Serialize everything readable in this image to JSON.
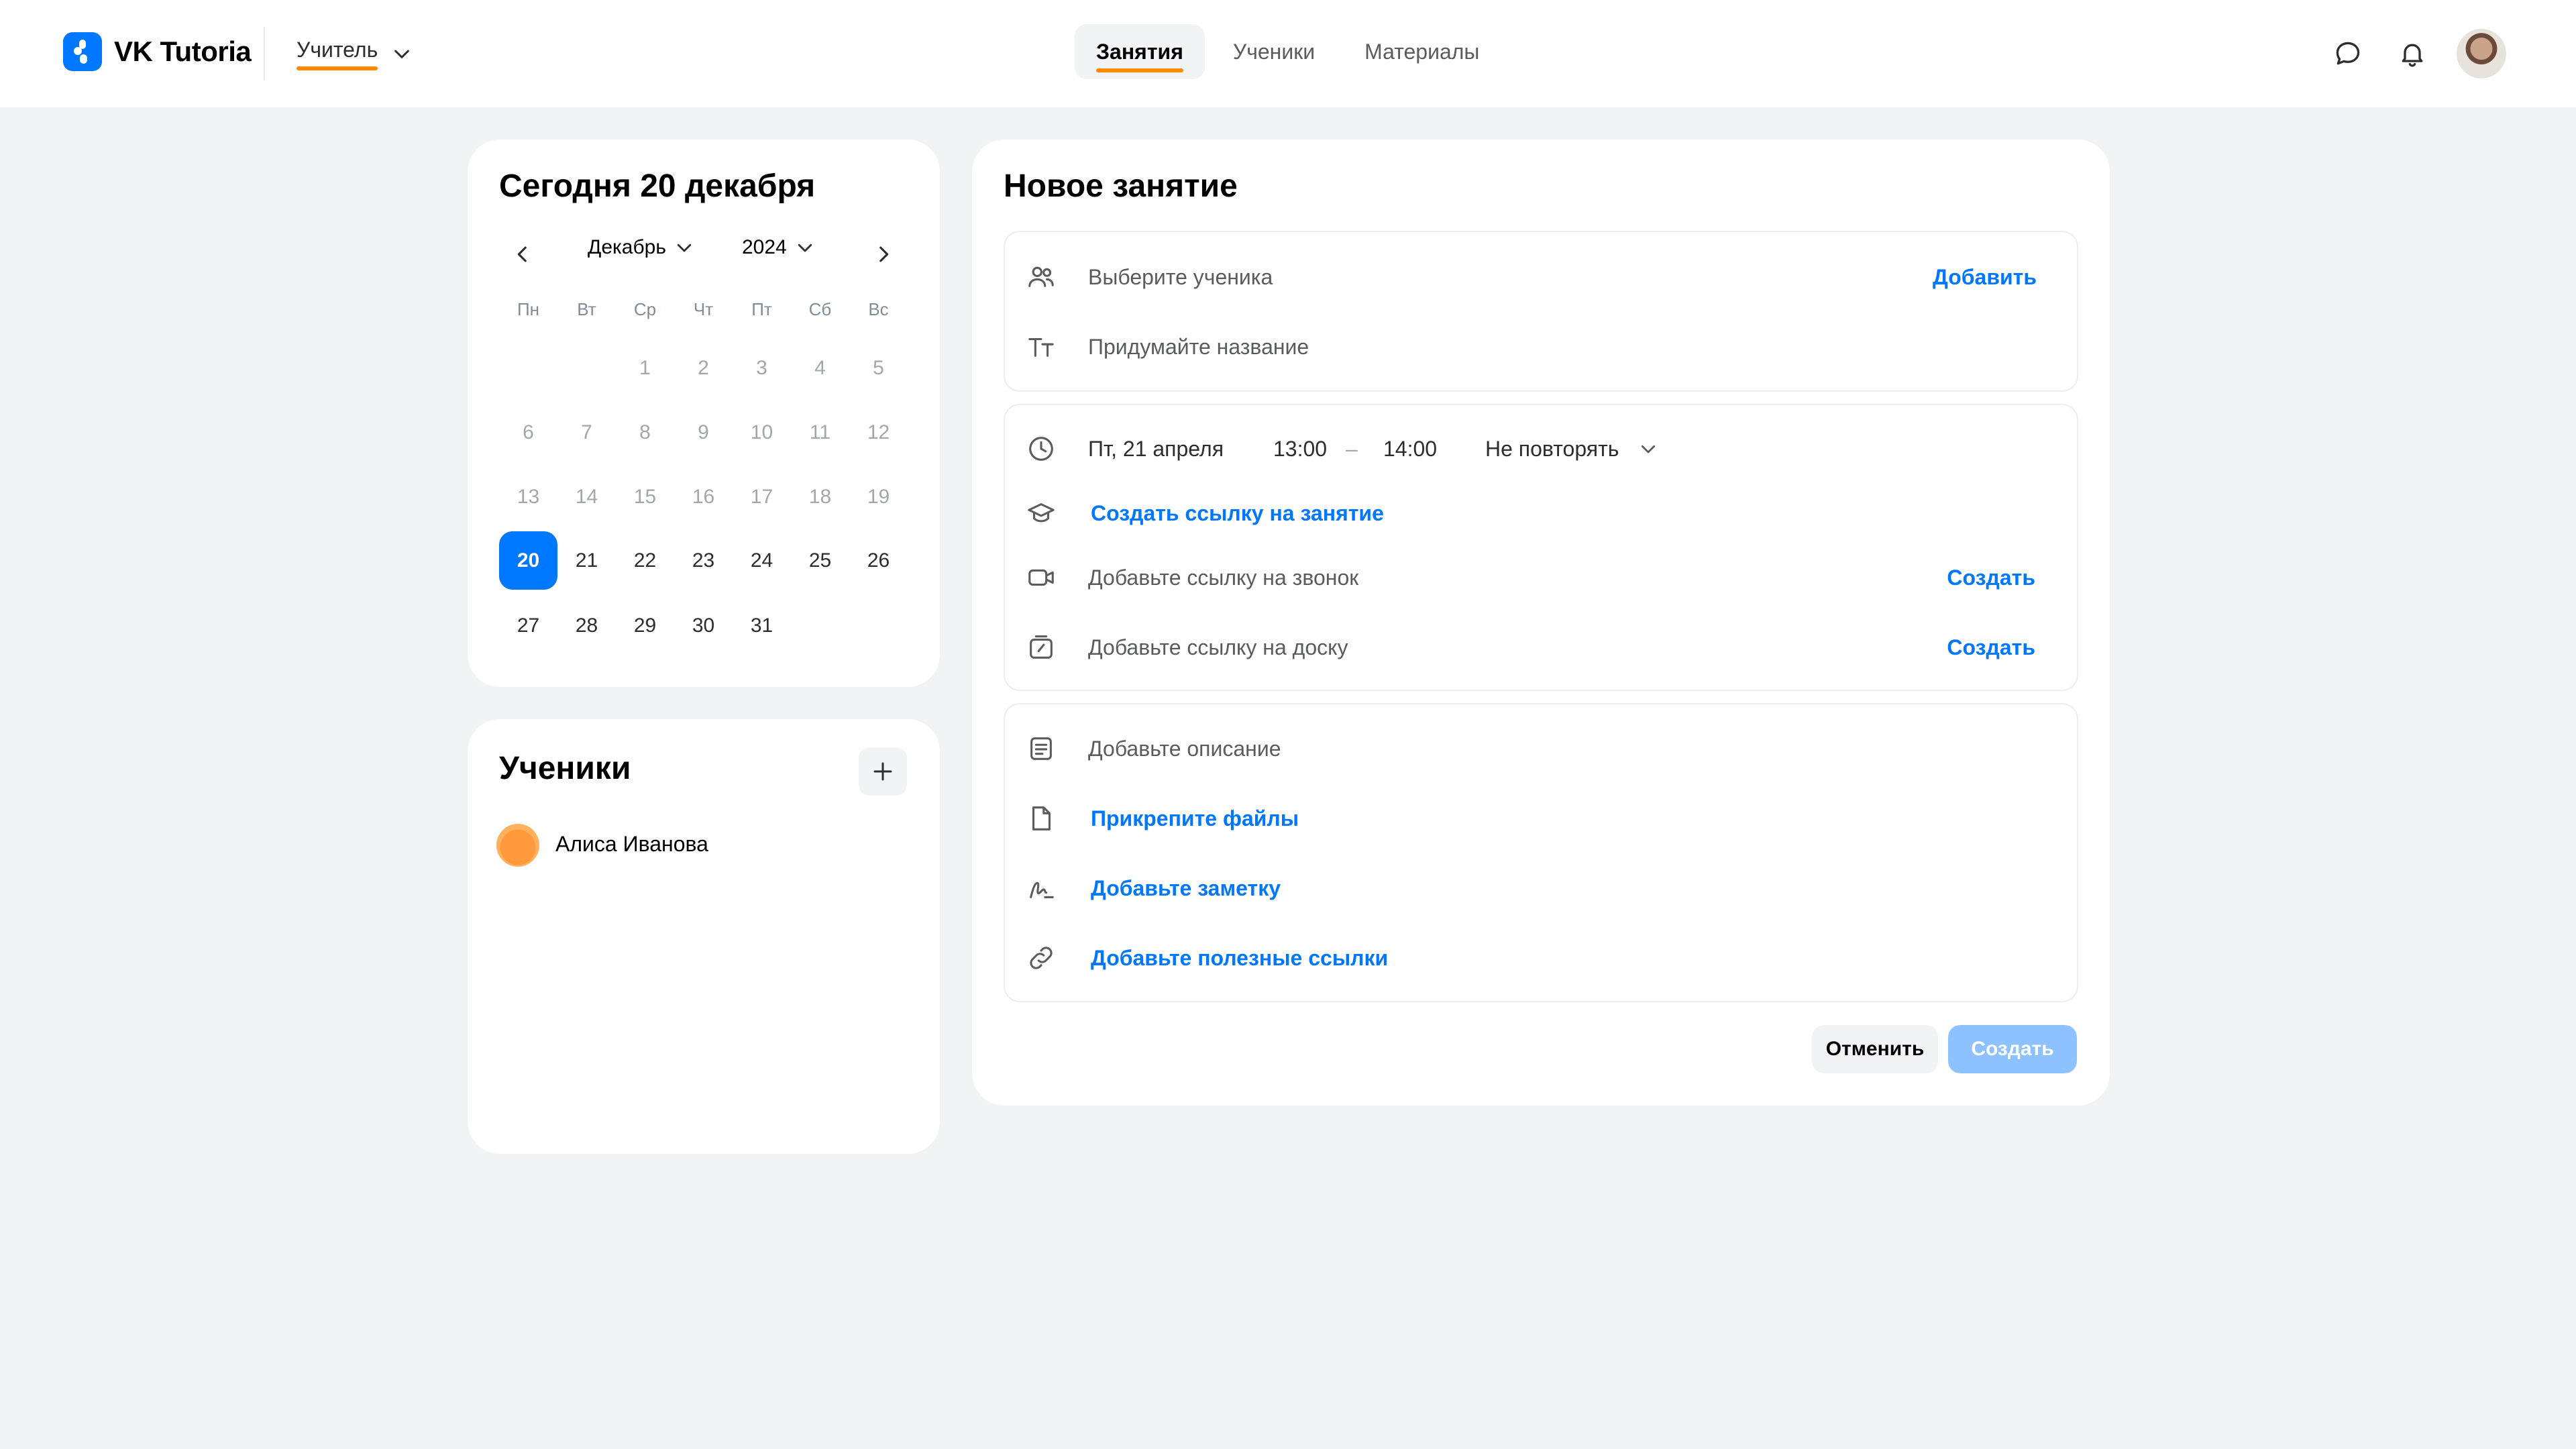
{
  "app": {
    "name": "VK Tutoria",
    "brand_color": "#0077ff",
    "accent_color": "#ff8a00"
  },
  "header": {
    "role": "Учитель",
    "tabs": [
      {
        "label": "Занятия",
        "active": true
      },
      {
        "label": "Ученики",
        "active": false
      },
      {
        "label": "Материалы",
        "active": false
      }
    ],
    "icons": [
      "chat-icon",
      "bell-icon",
      "avatar"
    ]
  },
  "calendar": {
    "title": "Сегодня 20 декабря",
    "month": "Декабрь",
    "year": "2024",
    "weekdays": [
      "Пн",
      "Вт",
      "Ср",
      "Чт",
      "Пт",
      "Сб",
      "Вс"
    ],
    "selected_day": "20",
    "weeks": [
      [
        "",
        "",
        "1",
        "2",
        "3",
        "4",
        "5"
      ],
      [
        "6",
        "7",
        "8",
        "9",
        "10",
        "11",
        "12"
      ],
      [
        "13",
        "14",
        "15",
        "16",
        "17",
        "18",
        "19"
      ],
      [
        "20",
        "21",
        "22",
        "23",
        "24",
        "25",
        "26"
      ],
      [
        "27",
        "28",
        "29",
        "30",
        "31",
        "",
        ""
      ]
    ]
  },
  "students": {
    "title": "Ученики",
    "list": [
      {
        "name": "Алиса Иванова"
      }
    ]
  },
  "lesson": {
    "title": "Новое занятие",
    "student_placeholder": "Выберите ученика",
    "add_label": "Добавить",
    "name_placeholder": "Придумайте название",
    "date": "Пт, 21 апреля",
    "time_start": "13:00",
    "time_separator": "–",
    "time_end": "14:00",
    "repeat": "Не повторять",
    "create_lesson_link": "Создать ссылку на занятие",
    "call_link_placeholder": "Добавьте ссылку на звонок",
    "board_link_placeholder": "Добавьте ссылку на доску",
    "create_label": "Создать",
    "description_placeholder": "Добавьте описание",
    "attach_files": "Прикрепите файлы",
    "add_note": "Добавьте заметку",
    "add_links": "Добавьте полезные ссылки",
    "cancel_button": "Отменить",
    "submit_button": "Создать"
  }
}
